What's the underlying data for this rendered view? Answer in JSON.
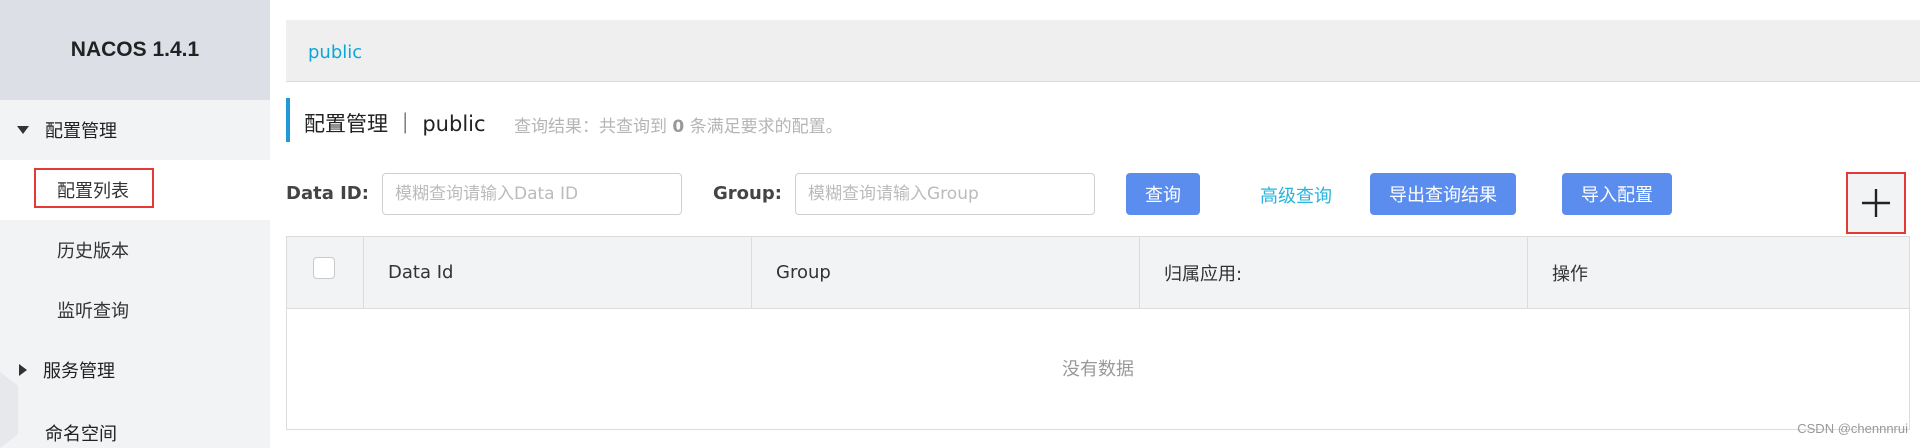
{
  "app": {
    "brand": "NACOS 1.4.1"
  },
  "sidebar": {
    "config_group": "配置管理",
    "items": [
      "配置列表",
      "历史版本",
      "监听查询"
    ],
    "service_group": "服务管理",
    "namespace": "命名空间"
  },
  "breadcrumb": {
    "namespace": "public"
  },
  "page": {
    "title": "配置管理 ｜ public",
    "summary_prefix": "查询结果：共查询到",
    "summary_count": "0",
    "summary_suffix": "条满足要求的配置。"
  },
  "filters": {
    "data_id_label": "Data ID:",
    "data_id_placeholder": "模糊查询请输入Data ID",
    "group_label": "Group:",
    "group_placeholder": "模糊查询请输入Group"
  },
  "buttons": {
    "query": "查询",
    "advanced": "高级查询",
    "export": "导出查询结果",
    "import": "导入配置",
    "add_icon": "plus-icon"
  },
  "table": {
    "headers": [
      "Data Id",
      "Group",
      "归属应用:",
      "操作"
    ],
    "empty_text": "没有数据"
  },
  "watermark": "CSDN @chennnrui"
}
